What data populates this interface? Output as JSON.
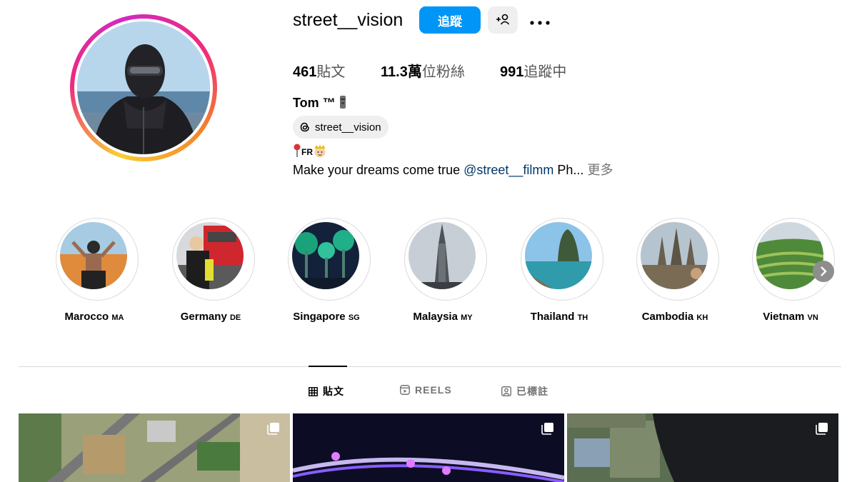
{
  "profile": {
    "username": "street__vision",
    "follow_label": "追蹤",
    "stats": {
      "posts_value": "461",
      "posts_label": "貼文",
      "followers_value": "11.3萬",
      "followers_label": "位粉絲",
      "following_value": "991",
      "following_label": "追蹤中"
    },
    "display_name": "Tom ™",
    "threads_handle": "street__vision",
    "bio_line1": "FR",
    "bio_text": "Make your dreams come true ",
    "bio_mention": "@street__filmm",
    "bio_tail": " Ph...",
    "bio_more": "更多"
  },
  "highlights": [
    {
      "name": "Marocco",
      "code": "MA"
    },
    {
      "name": "Germany",
      "code": "DE"
    },
    {
      "name": "Singapore",
      "code": "SG"
    },
    {
      "name": "Malaysia",
      "code": "MY"
    },
    {
      "name": "Thailand",
      "code": "TH"
    },
    {
      "name": "Cambodia",
      "code": "KH"
    },
    {
      "name": "Vietnam",
      "code": "VN"
    }
  ],
  "tabs": [
    {
      "label": "貼文",
      "icon": "grid-icon",
      "active": true
    },
    {
      "label": "REELS",
      "icon": "reels-icon",
      "active": false
    },
    {
      "label": "已標註",
      "icon": "tagged-icon",
      "active": false
    }
  ],
  "colors": {
    "accent": "#0095f6",
    "mention": "#00376b"
  }
}
